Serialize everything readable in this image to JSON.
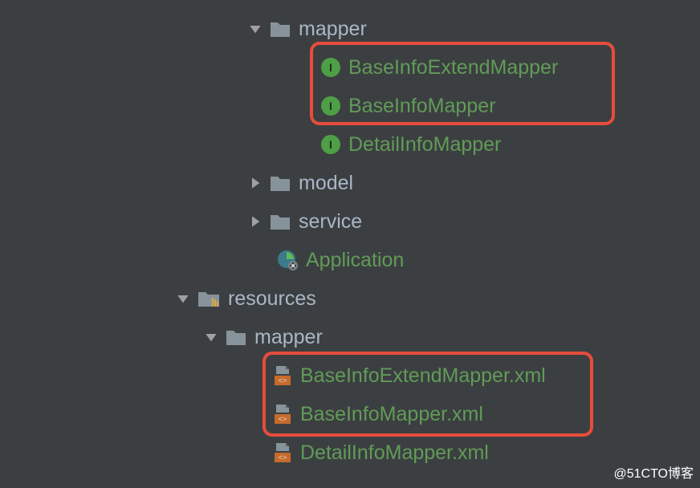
{
  "tree": {
    "mapper": {
      "label": "mapper",
      "items": [
        {
          "label": "BaseInfoExtendMapper"
        },
        {
          "label": "BaseInfoMapper"
        },
        {
          "label": "DetailInfoMapper"
        }
      ]
    },
    "model": {
      "label": "model"
    },
    "service": {
      "label": "service"
    },
    "application": {
      "label": "Application"
    },
    "resources": {
      "label": "resources",
      "mapper": {
        "label": "mapper",
        "items": [
          {
            "label": "BaseInfoExtendMapper.xml"
          },
          {
            "label": "BaseInfoMapper.xml"
          },
          {
            "label": "DetailInfoMapper.xml"
          }
        ]
      }
    }
  },
  "watermark": "@51CTO博客"
}
